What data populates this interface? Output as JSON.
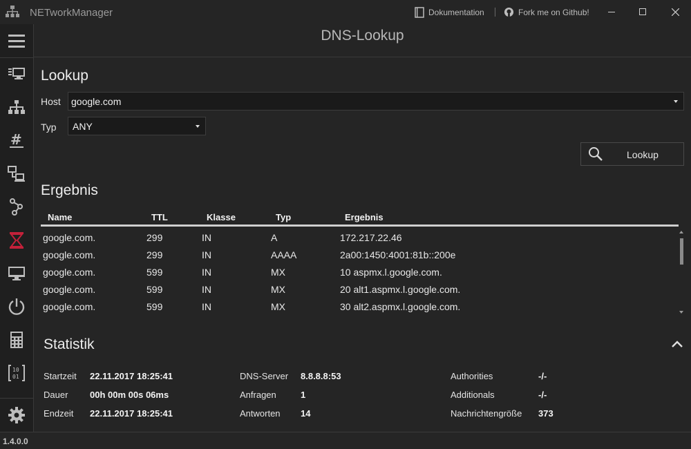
{
  "app": {
    "title": "NETworkManager",
    "version": "1.4.0.0"
  },
  "titlebar": {
    "docs_label": "Dokumentation",
    "github_label": "Fork me on Github!"
  },
  "sidebar": {
    "items": [
      {
        "name": "menu-icon"
      },
      {
        "name": "network-interface-icon"
      },
      {
        "name": "ip-scanner-icon"
      },
      {
        "name": "subnet-calculator-icon"
      },
      {
        "name": "remote-desktop-icon"
      },
      {
        "name": "traceroute-icon"
      },
      {
        "name": "dns-lookup-icon",
        "active": true
      },
      {
        "name": "monitor-icon"
      },
      {
        "name": "wake-on-lan-icon"
      },
      {
        "name": "calculator-icon"
      },
      {
        "name": "binary-icon"
      },
      {
        "name": "settings-icon"
      }
    ],
    "active_color": "#c4213a"
  },
  "page": {
    "title": "DNS-Lookup"
  },
  "lookup": {
    "title": "Lookup",
    "host_label": "Host",
    "host_value": "google.com",
    "type_label": "Typ",
    "type_value": "ANY",
    "button_label": "Lookup"
  },
  "result": {
    "title": "Ergebnis",
    "columns": [
      "Name",
      "TTL",
      "Klasse",
      "Typ",
      "Ergebnis"
    ],
    "rows": [
      [
        "google.com.",
        "299",
        "IN",
        "A",
        "172.217.22.46"
      ],
      [
        "google.com.",
        "299",
        "IN",
        "AAAA",
        "2a00:1450:4001:81b::200e"
      ],
      [
        "google.com.",
        "599",
        "IN",
        "MX",
        "10 aspmx.l.google.com."
      ],
      [
        "google.com.",
        "599",
        "IN",
        "MX",
        "20 alt1.aspmx.l.google.com."
      ],
      [
        "google.com.",
        "599",
        "IN",
        "MX",
        "30 alt2.aspmx.l.google.com."
      ]
    ]
  },
  "statistics": {
    "title": "Statistik",
    "start_label": "Startzeit",
    "start_value": "22.11.2017 18:25:41",
    "duration_label": "Dauer",
    "duration_value": "00h 00m 00s 06ms",
    "end_label": "Endzeit",
    "end_value": "22.11.2017 18:25:41",
    "dns_server_label": "DNS-Server",
    "dns_server_value": "8.8.8.8:53",
    "queries_label": "Anfragen",
    "queries_value": "1",
    "answers_label": "Antworten",
    "answers_value": "14",
    "authorities_label": "Authorities",
    "authorities_value": "-/-",
    "additionals_label": "Additionals",
    "additionals_value": "-/-",
    "msgsize_label": "Nachrichtengröße",
    "msgsize_value": "373"
  }
}
